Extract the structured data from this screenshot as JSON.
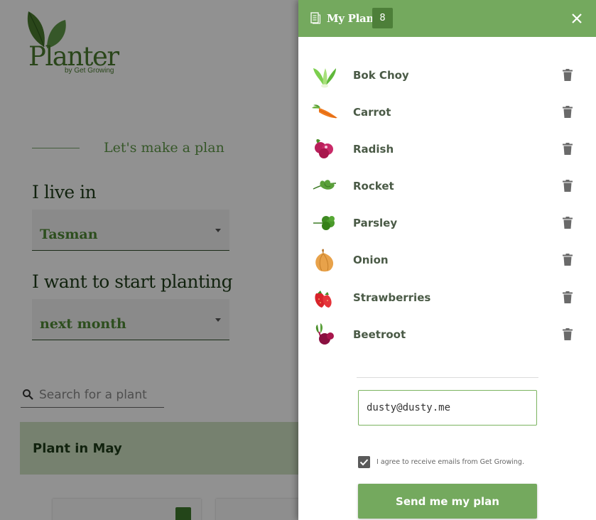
{
  "app": {
    "logo_word": "Planter",
    "logo_tagline": "by Get Growing"
  },
  "planner": {
    "intro": "Let's make a plan",
    "live_label": "I live in",
    "region": "Tasman",
    "start_label": "I want to start planting",
    "timing": "next month"
  },
  "search": {
    "placeholder": "Search for a plant",
    "icon": "search-icon"
  },
  "banner": {
    "text": "Plant in May"
  },
  "drawer": {
    "title": "My Plan",
    "count": "8",
    "close_icon": "close-icon",
    "items": [
      {
        "name": "Bok Choy",
        "icon": "bok-choy-thumbnail"
      },
      {
        "name": "Carrot",
        "icon": "carrot-thumbnail"
      },
      {
        "name": "Radish",
        "icon": "radish-thumbnail"
      },
      {
        "name": "Rocket",
        "icon": "rocket-thumbnail"
      },
      {
        "name": "Parsley",
        "icon": "parsley-thumbnail"
      },
      {
        "name": "Onion",
        "icon": "onion-thumbnail"
      },
      {
        "name": "Strawberries",
        "icon": "strawberries-thumbnail"
      },
      {
        "name": "Beetroot",
        "icon": "beetroot-thumbnail"
      }
    ],
    "email_value": "dusty@dusty.me",
    "agree_text": "I agree to receive emails from Get Growing.",
    "agree_checked": true,
    "send_label": "Send me my plan"
  },
  "colors": {
    "brand_green": "#74a95e",
    "dark_green": "#4d7f39",
    "text_dark": "#1f3d1a"
  }
}
